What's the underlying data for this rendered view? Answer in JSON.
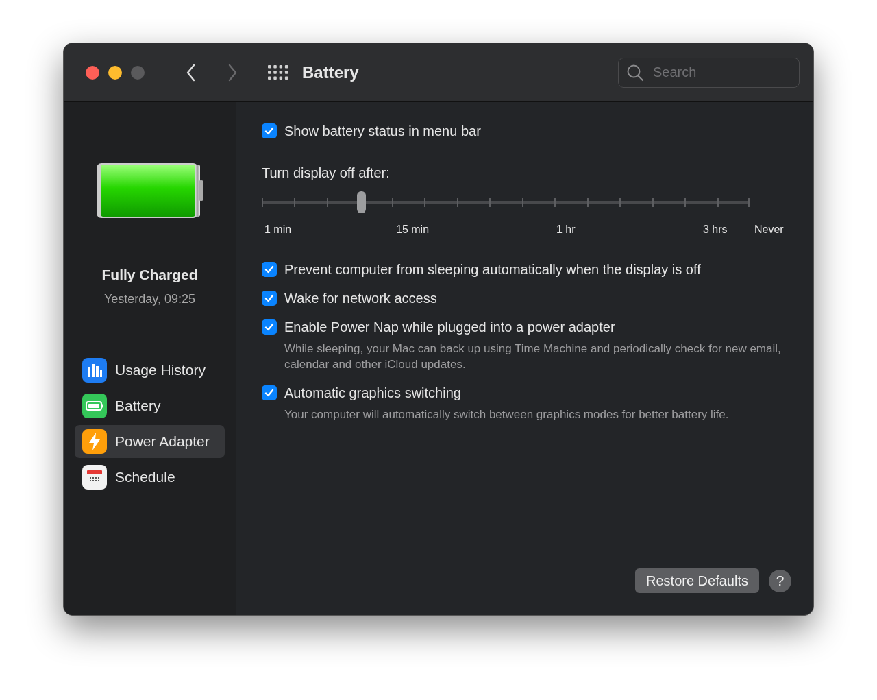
{
  "window": {
    "title": "Battery",
    "traffic_lights": [
      {
        "color": "#fe5f57"
      },
      {
        "color": "#febc2e"
      },
      {
        "color": "#5a5a5c"
      }
    ]
  },
  "toolbar": {
    "back": {
      "disabled": false
    },
    "forward": {
      "disabled": true
    },
    "search": {
      "placeholder": "Search"
    }
  },
  "sidebar": {
    "status": "Fully Charged",
    "time": "Yesterday, 09:25",
    "items": [
      {
        "label": "Usage History",
        "selected": false
      },
      {
        "label": "Battery",
        "selected": false
      },
      {
        "label": "Power Adapter",
        "selected": true
      },
      {
        "label": "Schedule",
        "selected": false
      }
    ]
  },
  "options_top": [
    {
      "label": "Show battery status in menu bar",
      "checked": true
    }
  ],
  "display_slider": {
    "label": "Turn display off after:",
    "level": 0.204,
    "ticks": [
      "1 min",
      "15 min",
      "1 hr",
      "3 hrs",
      "Never"
    ]
  },
  "options": [
    {
      "label": "Prevent computer from sleeping automatically when the display is off",
      "checked": true
    },
    {
      "label": "Wake for network access",
      "checked": true
    },
    {
      "label": "Enable Power Nap while plugged into a power adapter",
      "checked": true,
      "description": "While sleeping, your Mac can back up using Time Machine and periodically check for new email, calendar and other iCloud updates."
    },
    {
      "label": "Automatic graphics switching",
      "checked": true,
      "description": "Your computer will automatically switch between graphics modes for better battery life."
    }
  ],
  "buttons": {
    "restore": "Restore Defaults",
    "help": "?"
  }
}
